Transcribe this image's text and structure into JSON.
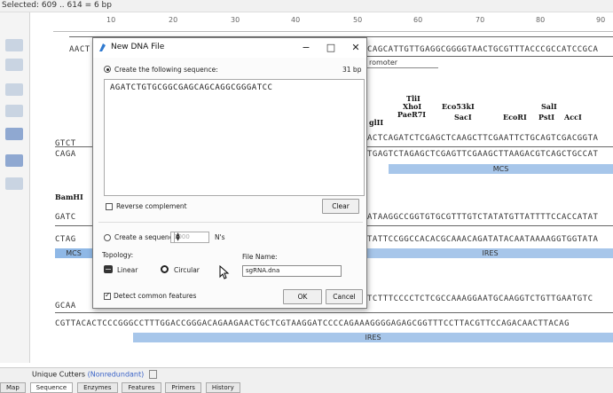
{
  "status": {
    "selected_text": "Selected: 609 .. 614 = 6 bp"
  },
  "ruler": {
    "ticks": [
      "10",
      "20",
      "30",
      "40",
      "50",
      "60",
      "70",
      "80",
      "90"
    ]
  },
  "sequence_rows": {
    "r1_left": "AACT",
    "r1_right": "CAGCATTGTTGAGGCGGGGTAACTGCGTTTACCCGCCATCCGCA",
    "r2_left": "GTCT",
    "r2_right": "ACTCAGATCTCGAGCTCAAGCTTCGAATTCTGCAGTCGACGGTA",
    "r3_left": "CAGA",
    "r3_right": "TGAGTCTAGAGCTCGAGTTCGAAGCTTAAGACGTCAGCTGCCAT",
    "r4_left": "GATC",
    "r4_right": "ATAAGGCCGGTGTGCGTTTGTCTATATGTTATTTTCCACCATAT",
    "r5_left": "CTAG",
    "r5_right": "TATTCCGGCCACACGCAAACAGATATACAATAAAAGGTGGTATA",
    "r6_left": "GCAA",
    "r6_right": "TCTTTCCCCTCTCGCCAAAGGAATGCAAGGTCTGTTGAATGTC",
    "r7_full": "CGTTACACTCCCGGGCCTTTGGACCGGGACAGAAGAACTGCTCGTAAGGATCCCCAGAAAGGGGAGAGCGGTTTCCTTACGTTCCAGACAACTTACAG"
  },
  "features": {
    "promoter": "romoter",
    "mcs": "MCS",
    "mcs_left": "MCS",
    "ires": "IRES",
    "ires2": "IRES"
  },
  "enzymes": {
    "bglii": "glII",
    "tlii": "TliI",
    "xhoi": "XhoI",
    "paer7i": "PaeR7I",
    "eco53ki": "Eco53kI",
    "saci": "SacI",
    "ecori": "EcoRI",
    "pstI": "PstI",
    "sali": "SalI",
    "acci": "AccI",
    "bamhi": "BamHI"
  },
  "dialog": {
    "title": "New DNA File",
    "create_following_label": "Create the following sequence:",
    "length_label": "31 bp",
    "sequence_value": "AGATCTGTGCGGCGAGCAGCAGGCGGGATCC",
    "reverse_complement_label": "Reverse complement",
    "clear_label": "Clear",
    "create_sequence_of_label": "Create a sequence of",
    "create_sequence_count": "1000",
    "ns_label": "N's",
    "topology_label": "Topology:",
    "linear_label": "Linear",
    "circular_label": "Circular",
    "file_name_label": "File Name:",
    "file_name_value": "sgRNA.dna",
    "detect_features_label": "Detect common features",
    "ok_label": "OK",
    "cancel_label": "Cancel",
    "minimize_glyph": "−",
    "maximize_glyph": "□",
    "close_glyph": "✕"
  },
  "bottom": {
    "unique_cutters_label": "Unique Cutters",
    "nonredundant_label": "(Nonredundant)",
    "tabs": [
      "Map",
      "Sequence",
      "Enzymes",
      "Features",
      "Primers",
      "History"
    ]
  }
}
